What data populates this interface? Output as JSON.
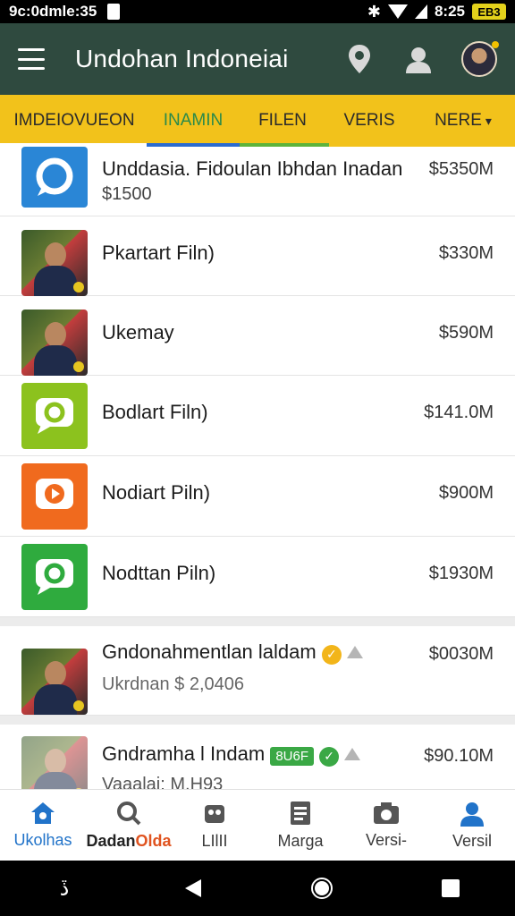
{
  "status_bar": {
    "time": "9c:0dmle:35",
    "clock_right": "8:25",
    "battery": "EB3"
  },
  "app_bar": {
    "title": "Undohan Indoneiai",
    "icons": [
      "menu-icon",
      "map-pin-icon",
      "account-icon",
      "avatar"
    ]
  },
  "tabs": [
    {
      "label": "IMDEIOVUEON"
    },
    {
      "label": "INAMIN"
    },
    {
      "label": "FILEN"
    },
    {
      "label": "VERIS"
    },
    {
      "label": "NERE"
    }
  ],
  "list": {
    "rows": [
      {
        "name": "Unddasia. Fidoulan Ibhdan Inadan",
        "sub": "$1500",
        "price": "$5350M",
        "icon": "chat-bubble-icon",
        "icon_bg": "#2a86d6"
      },
      {
        "name": "Pkartart Filn)",
        "price": "$330M",
        "icon": "photo-thumbnail"
      },
      {
        "name": "Ukemay",
        "price": "$590M",
        "icon": "photo-thumbnail"
      },
      {
        "name": "Bodlart Filn)",
        "price": "$141.0M",
        "icon": "camera-bubble-icon",
        "icon_bg": "#8cc21e"
      },
      {
        "name": "Nodiart Piln)",
        "price": "$900M",
        "icon": "play-bubble-icon",
        "icon_bg": "#f06a1e"
      },
      {
        "name": "Nodttan Piln)",
        "price": "$1930M",
        "icon": "camera-bubble-icon",
        "icon_bg": "#2fab3e"
      }
    ],
    "cards": [
      {
        "name": "Gndonahmentlan laldam",
        "sub": "Ukrdnan $ 2,0406",
        "price": "$0030M",
        "badge_color": "#f2b51a"
      },
      {
        "name": "Gndramha l Indam",
        "badge_text": "8U6F",
        "sub": "Vaaalai: M.H93",
        "price": "$90.10M",
        "badge_color": "#3aa845"
      }
    ]
  },
  "bottom_nav": [
    {
      "label": "Ukolhas",
      "icon": "home-gear-icon",
      "active": true
    },
    {
      "label": "Dadan",
      "label_alt": "Olda",
      "icon": "search-icon"
    },
    {
      "label": "LIlII",
      "icon": "robot-icon"
    },
    {
      "label": "Marga",
      "icon": "document-icon"
    },
    {
      "label": "Versi-",
      "icon": "camera-icon"
    },
    {
      "label": "Versil",
      "icon": "person-icon"
    }
  ],
  "colors": {
    "app_bar": "#2f4a3f",
    "tabs_bg": "#f2c21b",
    "active_tab": "#2a8a4a",
    "accent_blue": "#2173c9"
  }
}
